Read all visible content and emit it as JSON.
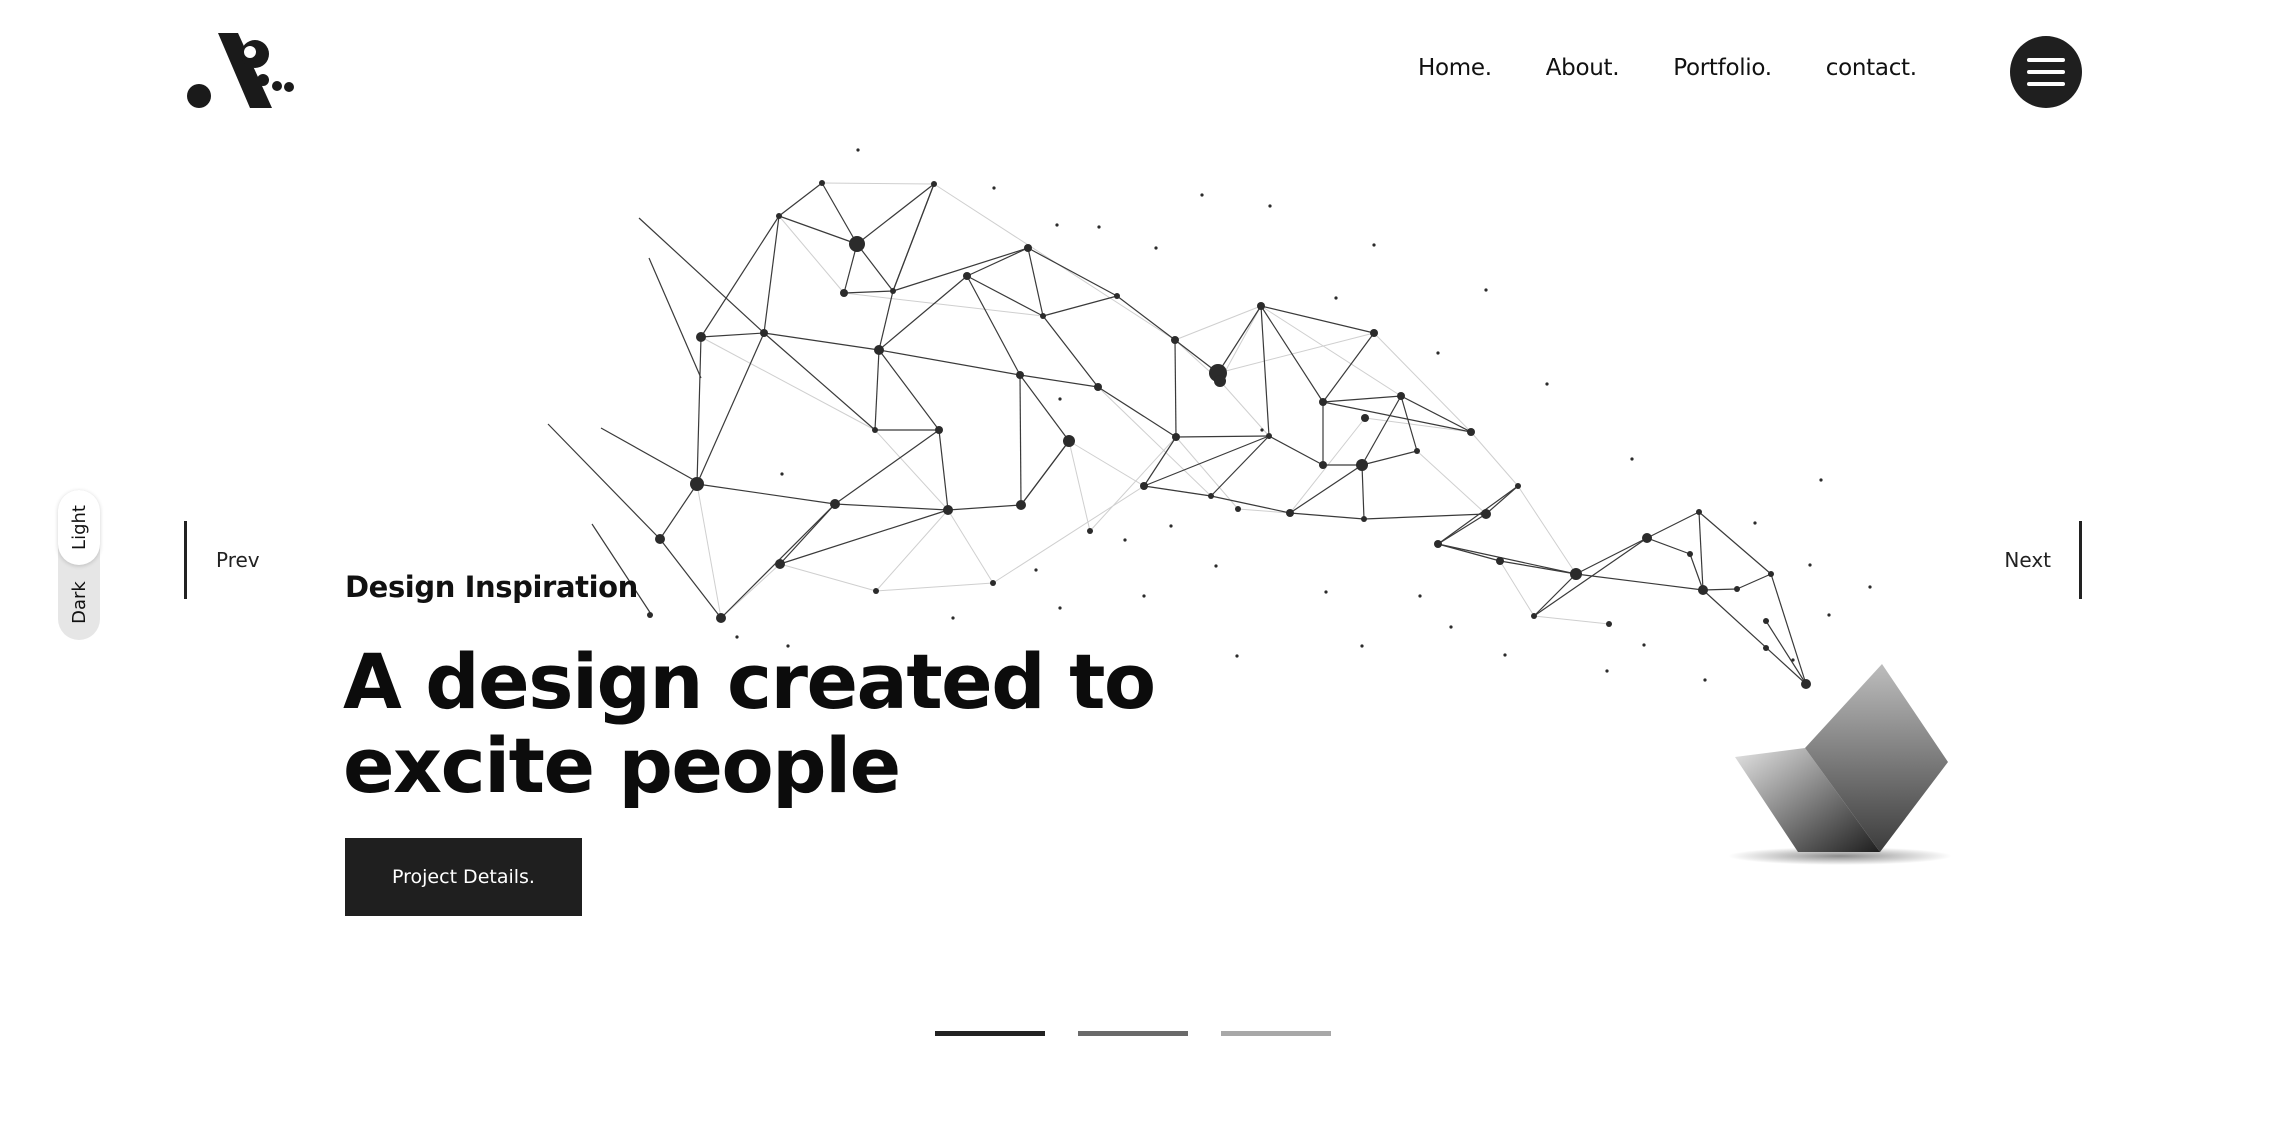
{
  "nav": {
    "items": [
      {
        "label": "Home."
      },
      {
        "label": "About."
      },
      {
        "label": "Portfolio."
      },
      {
        "label": "contact."
      }
    ],
    "menu_icon": "hamburger-icon"
  },
  "logo": {
    "icon": "logo-mark-icon"
  },
  "theme_toggle": {
    "light_label": "Light",
    "dark_label": "Dark",
    "selected": "Light"
  },
  "slider": {
    "prev_label": "Prev",
    "next_label": "Next"
  },
  "hero": {
    "eyebrow": "Design Inspiration",
    "headline": "A design created to excite people",
    "cta_label": "Project Details."
  },
  "pagination": {
    "count": 3,
    "active_index": 0,
    "colors": [
      "#222222",
      "#6a6a6a",
      "#a8a8a8"
    ]
  },
  "colors": {
    "accent_dark": "#1f1f1f",
    "background": "#ffffff",
    "network_line": "#3a3a3a"
  }
}
